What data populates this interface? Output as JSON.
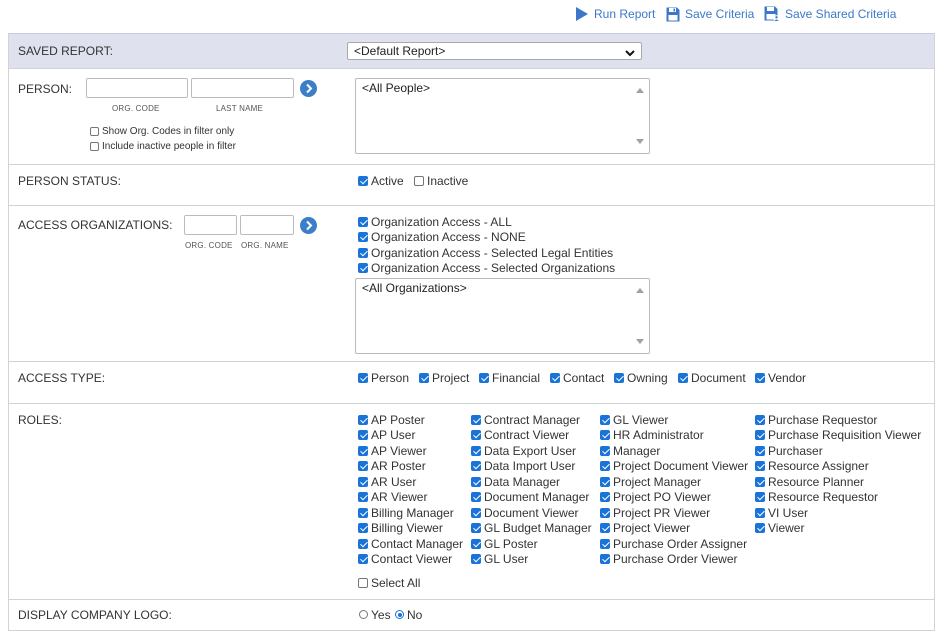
{
  "toolbar": {
    "run_report": "Run Report",
    "save_criteria": "Save Criteria",
    "save_shared_criteria": "Save Shared Criteria",
    "accent_color": "#3c78c8"
  },
  "saved_report": {
    "label": "SAVED REPORT:",
    "selected": "<Default Report>"
  },
  "person": {
    "label": "PERSON:",
    "org_code_label": "ORG. CODE",
    "last_name_label": "LAST NAME",
    "org_code_value": "",
    "last_name_value": "",
    "show_org_codes": "Show Org. Codes in filter only",
    "include_inactive": "Include inactive people in filter",
    "list_item": "<All People>"
  },
  "person_status": {
    "label": "PERSON STATUS:",
    "active": "Active",
    "inactive": "Inactive"
  },
  "access_orgs": {
    "label": "ACCESS ORGANIZATIONS:",
    "org_code_label": "ORG. CODE",
    "org_name_label": "ORG. NAME",
    "options": [
      "Organization Access - ALL",
      "Organization Access - NONE",
      "Organization Access - Selected Legal Entities",
      "Organization Access - Selected Organizations"
    ],
    "list_item": "<All Organizations>"
  },
  "access_type": {
    "label": "ACCESS TYPE:",
    "options": [
      "Person",
      "Project",
      "Financial",
      "Contact",
      "Owning",
      "Document",
      "Vendor"
    ]
  },
  "roles": {
    "label": "ROLES:",
    "columns": [
      [
        "AP Poster",
        "AP User",
        "AP Viewer",
        "AR Poster",
        "AR User",
        "AR Viewer",
        "Billing Manager",
        "Billing Viewer",
        "Contact Manager",
        "Contact Viewer"
      ],
      [
        "Contract Manager",
        "Contract Viewer",
        "Data Export User",
        "Data Import User",
        "Data Manager",
        "Document Manager",
        "Document Viewer",
        "GL Budget Manager",
        "GL Poster",
        "GL User"
      ],
      [
        "GL Viewer",
        "HR Administrator",
        "Manager",
        "Project Document Viewer",
        "Project Manager",
        "Project PO Viewer",
        "Project PR Viewer",
        "Project Viewer",
        "Purchase Order Assigner",
        "Purchase Order Viewer"
      ],
      [
        "Purchase Requestor",
        "Purchase Requisition Viewer",
        "Purchaser",
        "Resource Assigner",
        "Resource Planner",
        "Resource Requestor",
        "VI User",
        "Viewer"
      ]
    ],
    "select_all": "Select All"
  },
  "display_logo": {
    "label": "DISPLAY COMPANY LOGO:",
    "yes": "Yes",
    "no": "No"
  }
}
